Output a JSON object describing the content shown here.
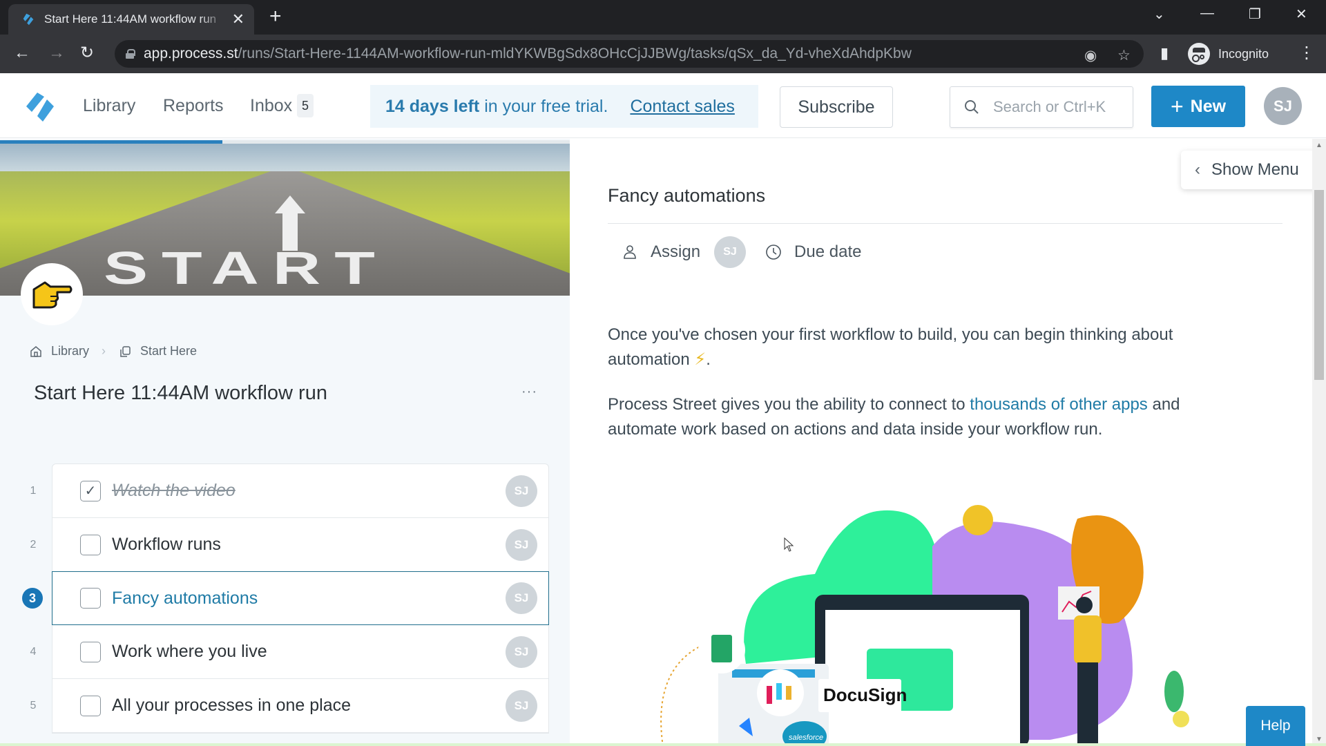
{
  "browser": {
    "tab_title": "Start Here 11:44AM workflow run",
    "new_tab_label": "+",
    "url_host": "app.process.st",
    "url_path": "/runs/Start-Here-1144AM-workflow-run-mldYKWBgSdx8OHcCjJJBWg/tasks/qSx_da_Yd-vheXdAhdpKbw",
    "profile_label": "Incognito"
  },
  "header": {
    "nav": [
      {
        "label": "Library"
      },
      {
        "label": "Reports"
      },
      {
        "label": "Inbox"
      }
    ],
    "inbox_count": "5",
    "trial": {
      "days_left": "14 days left",
      "rest": "in your free trial.",
      "contact_label": "Contact sales"
    },
    "subscribe_label": "Subscribe",
    "search_placeholder": "Search or Ctrl+K",
    "new_label": "New",
    "user_initials": "SJ",
    "accent_color": "#1e88c7"
  },
  "run": {
    "progress_percent": 39,
    "hero_text": "START",
    "emoji": "point-right-emoji",
    "breadcrumb": [
      {
        "label": "Library",
        "icon": "home-icon"
      },
      {
        "label": "Start Here",
        "icon": "template-icon"
      }
    ],
    "title": "Start Here 11:44AM workflow run",
    "more_label": "···",
    "tasks": [
      {
        "num": "1",
        "label": "Watch the video",
        "checked": true,
        "active": false,
        "assignee": "SJ"
      },
      {
        "num": "2",
        "label": "Workflow runs",
        "checked": false,
        "active": false,
        "assignee": "SJ"
      },
      {
        "num": "3",
        "label": "Fancy automations",
        "checked": false,
        "active": true,
        "assignee": "SJ"
      },
      {
        "num": "4",
        "label": "Work where you live",
        "checked": false,
        "active": false,
        "assignee": "SJ"
      },
      {
        "num": "5",
        "label": "All your processes in one place",
        "checked": false,
        "active": false,
        "assignee": "SJ"
      }
    ]
  },
  "task_detail": {
    "title": "Fancy automations",
    "assign_label": "Assign",
    "assignee_initials": "SJ",
    "due_label": "Due date",
    "show_menu_label": "Show Menu",
    "paragraph1_a": "Once you've chosen your first workflow to build, you can begin thinking about automation",
    "paragraph1_b": ".",
    "bolt": "⚡",
    "paragraph2_a": "Process Street gives you the ability to connect to",
    "paragraph2_link": "thousands of other apps",
    "paragraph2_b": "and automate work based on actions and data inside your workflow run.",
    "illustration_logos": [
      "Google Sheets",
      "Slack",
      "DocuSign",
      "Jira",
      "Salesforce"
    ],
    "docusign_label": "DocuSign",
    "salesforce_label": "salesforce"
  },
  "help_label": "Help"
}
